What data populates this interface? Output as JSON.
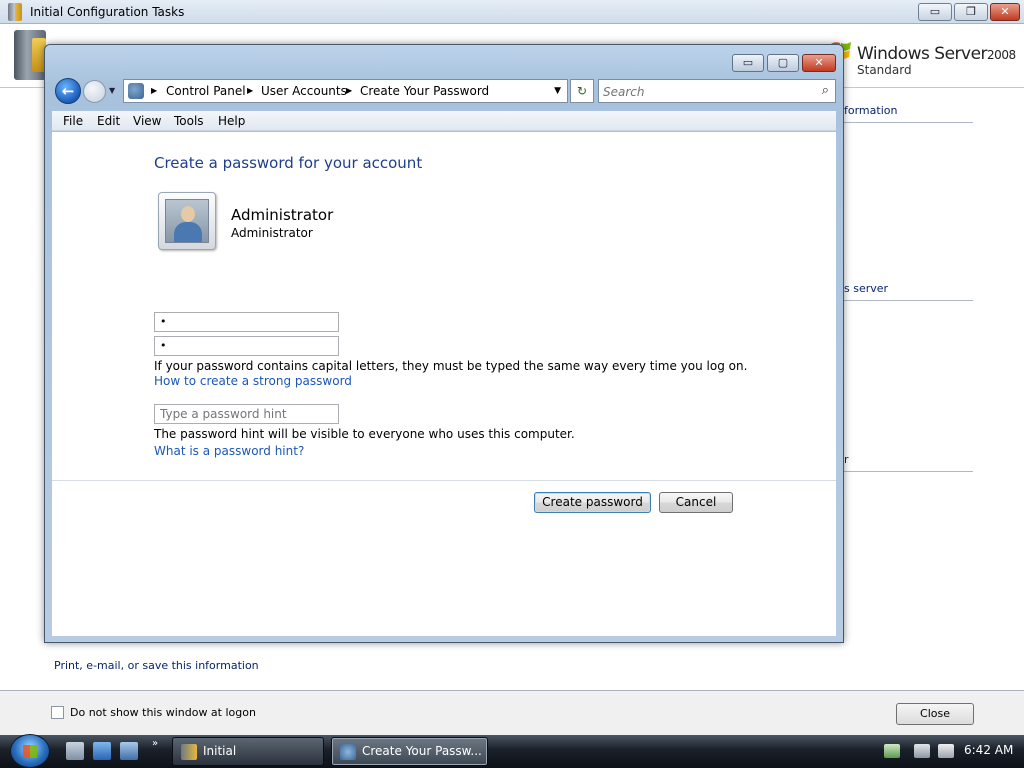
{
  "background_window": {
    "title": "Initial Configuration Tasks",
    "caption_buttons": {
      "minimize": "▭",
      "restore": "❐",
      "close": "✕"
    },
    "brand": {
      "name": "Windows Server",
      "version": "2008",
      "edition": "Standard"
    },
    "partial_links": [
      "formation",
      "s server",
      "r"
    ],
    "print_link": "Print, e-mail, or save this information",
    "checkbox_label": "Do not show this window at logon",
    "close_button": "Close"
  },
  "dialog": {
    "caption_buttons": {
      "minimize": "▭",
      "maximize": "▢",
      "close": "✕"
    },
    "back_glyph": "←",
    "refresh_glyph": "↻",
    "breadcrumbs": [
      "Control Panel",
      "User Accounts",
      "Create Your Password"
    ],
    "search": {
      "placeholder": "Search",
      "icon": "search-icon"
    },
    "menu": [
      "File",
      "Edit",
      "View",
      "Tools",
      "Help"
    ],
    "heading": "Create a password for your account",
    "user": {
      "name": "Administrator",
      "role": "Administrator"
    },
    "new_password_value": "•",
    "confirm_password_value": "•",
    "password_note": "If your password contains capital letters, they must be typed the same way every time you log on.",
    "strong_password_link": "How to create a strong password",
    "hint": {
      "placeholder": "Type a password hint",
      "value": ""
    },
    "hint_note": "The password hint will be visible to everyone who uses this computer.",
    "hint_link": "What is a password hint?",
    "buttons": {
      "create": "Create password",
      "cancel": "Cancel"
    }
  },
  "taskbar": {
    "chevron": "»",
    "tasks": [
      {
        "label": "Initial Configuratio...",
        "active": false
      },
      {
        "label": "Create Your Passw...",
        "active": true
      }
    ],
    "clock": "6:42 AM"
  },
  "colors": {
    "link": "#1c57b8",
    "heading": "#1e3f8a",
    "taskbar": "#1a2029"
  }
}
